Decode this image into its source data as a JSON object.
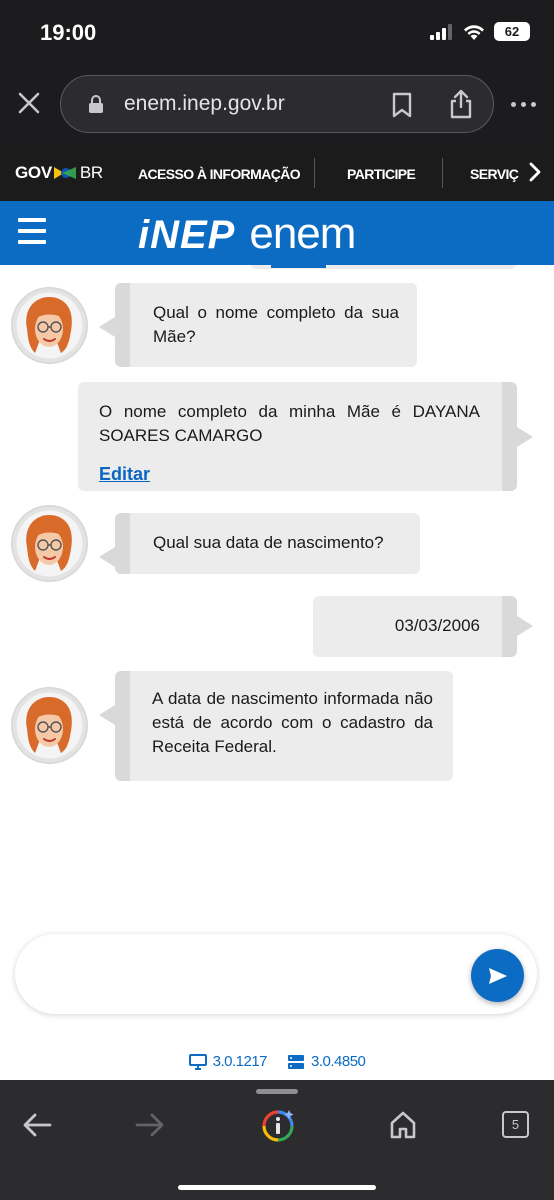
{
  "status_bar": {
    "time": "19:00",
    "battery": "62"
  },
  "browser": {
    "url": "enem.inep.gov.br",
    "tab_count": "5"
  },
  "gov_nav": {
    "logo_gov": "GOV",
    "logo_br": "BR",
    "links": [
      "ACESSO À INFORMAÇÃO",
      "PARTICIPE",
      "SERVIÇ"
    ]
  },
  "header": {
    "brand_inep": "iNEP",
    "brand_enem": "enem"
  },
  "chat": {
    "q1": "Qual o nome completo da sua Mãe?",
    "a1": "O nome completo da minha Mãe é DAYANA SOARES CAMARGO",
    "edit_label": "Editar",
    "q2": "Qual sua data de nascimento?",
    "a2": "03/03/2006",
    "msg3": "A data de nascimento informada não está de acordo com o cadastro da Receita Federal."
  },
  "input": {
    "placeholder": ""
  },
  "versions": {
    "frontend": "3.0.1217",
    "backend": "3.0.4850"
  },
  "colors": {
    "brand_blue": "#0c6cc4",
    "bubble": "#ececec",
    "link": "#0a66c2"
  }
}
